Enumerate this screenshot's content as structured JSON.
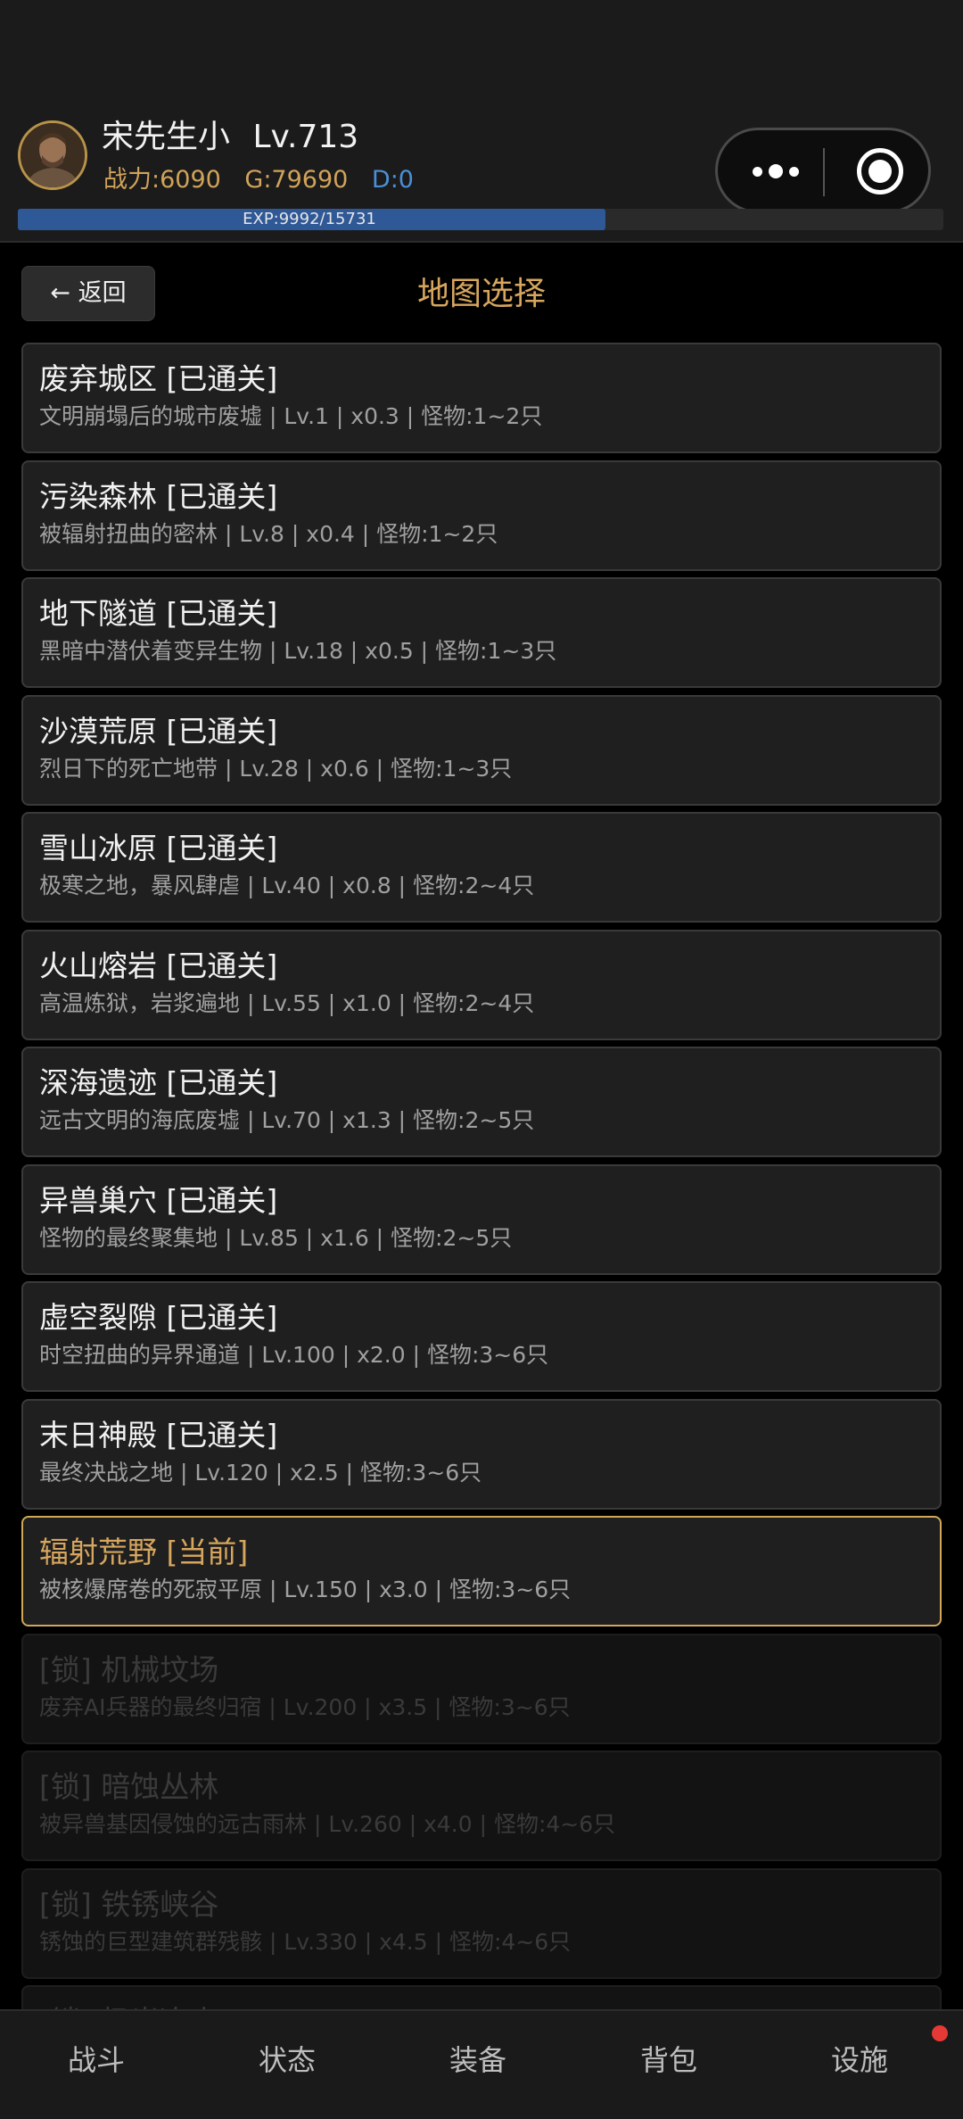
{
  "player": {
    "name": "宋先生小",
    "level": "Lv.713",
    "power": "战力:6090",
    "gold": "G:79690",
    "diamond": "D:0",
    "exp_text": "EXP:9992/15731",
    "exp_progress": 0.635
  },
  "header_buttons": {
    "more_icon": "more-icon",
    "target_icon": "target-icon"
  },
  "page": {
    "back_label": "← 返回",
    "title": "地图选择"
  },
  "maps": [
    {
      "title": "废弃城区 [已通关]",
      "desc": "文明崩塌后的城市废墟 | Lv.1 | x0.3 | 怪物:1~2只",
      "state": "cleared"
    },
    {
      "title": "污染森林 [已通关]",
      "desc": "被辐射扭曲的密林 | Lv.8 | x0.4 | 怪物:1~2只",
      "state": "cleared"
    },
    {
      "title": "地下隧道 [已通关]",
      "desc": "黑暗中潜伏着变异生物 | Lv.18 | x0.5 | 怪物:1~3只",
      "state": "cleared"
    },
    {
      "title": "沙漠荒原 [已通关]",
      "desc": "烈日下的死亡地带 | Lv.28 | x0.6 | 怪物:1~3只",
      "state": "cleared"
    },
    {
      "title": "雪山冰原 [已通关]",
      "desc": "极寒之地，暴风肆虐 | Lv.40 | x0.8 | 怪物:2~4只",
      "state": "cleared"
    },
    {
      "title": "火山熔岩 [已通关]",
      "desc": "高温炼狱，岩浆遍地 | Lv.55 | x1.0 | 怪物:2~4只",
      "state": "cleared"
    },
    {
      "title": "深海遗迹 [已通关]",
      "desc": "远古文明的海底废墟 | Lv.70 | x1.3 | 怪物:2~5只",
      "state": "cleared"
    },
    {
      "title": "异兽巢穴 [已通关]",
      "desc": "怪物的最终聚集地 | Lv.85 | x1.6 | 怪物:2~5只",
      "state": "cleared"
    },
    {
      "title": "虚空裂隙 [已通关]",
      "desc": "时空扭曲的异界通道 | Lv.100 | x2.0 | 怪物:3~6只",
      "state": "cleared"
    },
    {
      "title": "末日神殿 [已通关]",
      "desc": "最终决战之地 | Lv.120 | x2.5 | 怪物:3~6只",
      "state": "cleared"
    },
    {
      "title": "辐射荒野 [当前]",
      "desc": "被核爆席卷的死寂平原 | Lv.150 | x3.0 | 怪物:3~6只",
      "state": "current"
    },
    {
      "title": "[锁] 机械坟场",
      "desc": "废弃AI兵器的最终归宿 | Lv.200 | x3.5 | 怪物:3~6只",
      "state": "locked"
    },
    {
      "title": "[锁] 暗蚀丛林",
      "desc": "被异兽基因侵蚀的远古雨林 | Lv.260 | x4.0 | 怪物:4~6只",
      "state": "locked"
    },
    {
      "title": "[锁] 铁锈峡谷",
      "desc": "锈蚀的巨型建筑群残骸 | Lv.330 | x4.5 | 怪物:4~6只",
      "state": "locked"
    },
    {
      "title": "[锁] 极光冻土",
      "desc": "",
      "state": "locked"
    }
  ],
  "nav": {
    "items": [
      "战斗",
      "状态",
      "装备",
      "背包",
      "设施"
    ],
    "notification_on": "设施"
  },
  "colors": {
    "accent_gold": "#d6a65e",
    "diamond_blue": "#4a8fd9",
    "exp_fill": "#2f5896",
    "notification": "#e53935"
  }
}
